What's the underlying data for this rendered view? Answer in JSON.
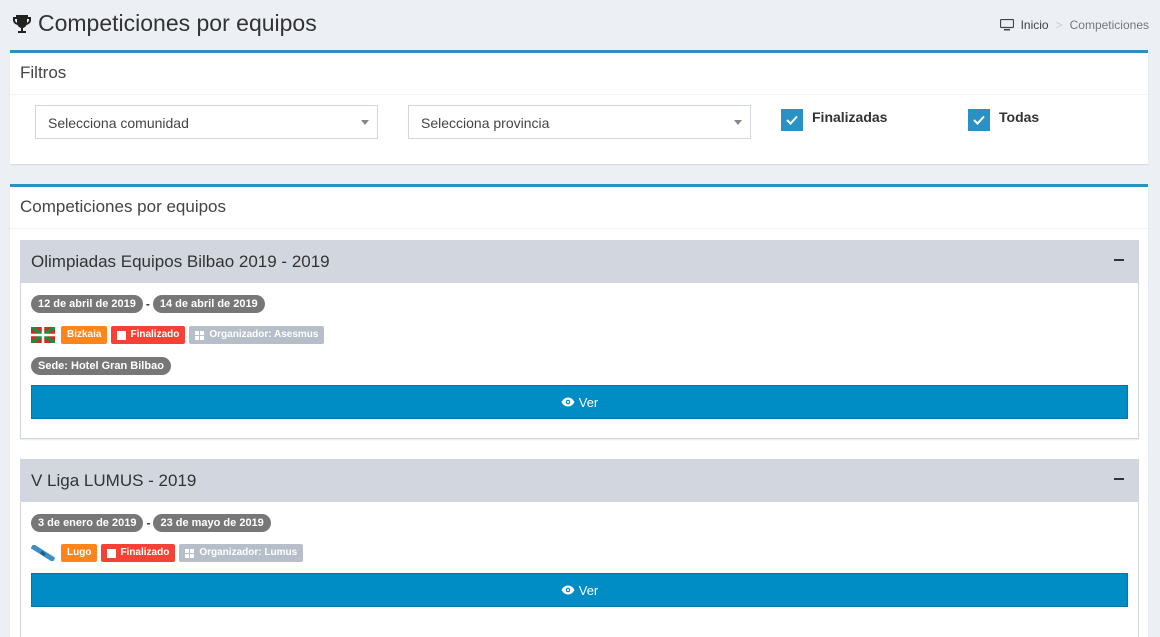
{
  "header": {
    "title": "Competiciones por equipos",
    "breadcrumb": {
      "home": "Inicio",
      "current": "Competiciones"
    }
  },
  "filters": {
    "title": "Filtros",
    "comunidad_placeholder": "Selecciona comunidad",
    "provincia_placeholder": "Selecciona provincia",
    "finalizadas_label": "Finalizadas",
    "finalizadas_checked": true,
    "todas_label": "Todas",
    "todas_checked": true
  },
  "list": {
    "title": "Competiciones por equipos",
    "competitions": [
      {
        "name": "Olimpiadas Equipos Bilbao 2019 - 2019",
        "start_date": "12 de abril de 2019",
        "end_date": "14 de abril de 2019",
        "province": "Bizkaia",
        "status": "Finalizado",
        "organizer": "Organizador: Asesmus",
        "venue": "Sede: Hotel Gran Bilbao",
        "button": "Ver"
      },
      {
        "name": "V Liga LUMUS - 2019",
        "start_date": "3 de enero de 2019",
        "end_date": "23 de mayo de 2019",
        "province": "Lugo",
        "status": "Finalizado",
        "organizer": "Organizador: Lumus",
        "button": "Ver"
      }
    ]
  },
  "colors": {
    "accent": "#2a91c4",
    "button": "#008cc4",
    "tag_orange": "#ff851b",
    "tag_red": "#f44336",
    "tag_gray": "#b6bec9",
    "pill": "#777777"
  }
}
